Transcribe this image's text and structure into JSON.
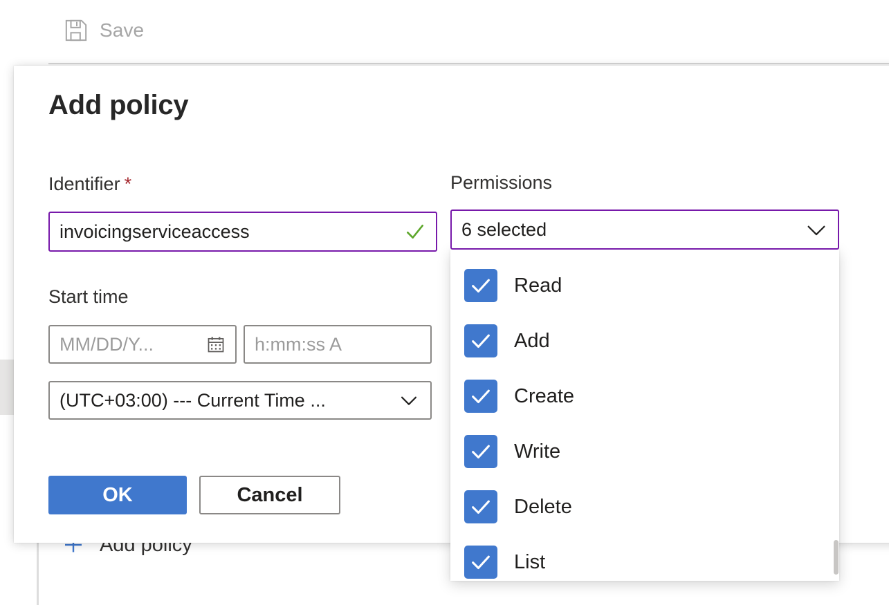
{
  "command_bar": {
    "save_label": "Save",
    "save_icon": "floppy-disk-save-icon",
    "save_disabled": true
  },
  "background": {
    "add_policy_label": "Add policy",
    "add_policy_icon": "plus-icon"
  },
  "panel": {
    "title": "Add policy",
    "identifier": {
      "label": "Identifier",
      "required_marker": "*",
      "value": "invoicingserviceaccess",
      "validation_icon": "checkmark-icon",
      "focused": true
    },
    "start_time": {
      "label": "Start time",
      "date_placeholder": "MM/DD/Y...",
      "date_icon": "calendar-icon",
      "time_placeholder": "h:mm:ss A",
      "timezone_value": "(UTC+03:00) --- Current Time ...",
      "timezone_icon": "chevron-down-icon"
    },
    "permissions": {
      "label": "Permissions",
      "selected_summary": "6 selected",
      "expand_icon": "chevron-down-icon",
      "expanded": true,
      "options": [
        {
          "label": "Read",
          "checked": true
        },
        {
          "label": "Add",
          "checked": true
        },
        {
          "label": "Create",
          "checked": true
        },
        {
          "label": "Write",
          "checked": true
        },
        {
          "label": "Delete",
          "checked": true
        },
        {
          "label": "List",
          "checked": true
        }
      ]
    },
    "actions": {
      "ok_label": "OK",
      "cancel_label": "Cancel"
    }
  },
  "colors": {
    "primary_blue": "#4078cd",
    "focus_purple": "#7719aa",
    "required_red": "#a4262c",
    "validation_green": "#5ea72c",
    "disabled_gray": "#a6a6a6",
    "border_gray": "#8a8886"
  }
}
